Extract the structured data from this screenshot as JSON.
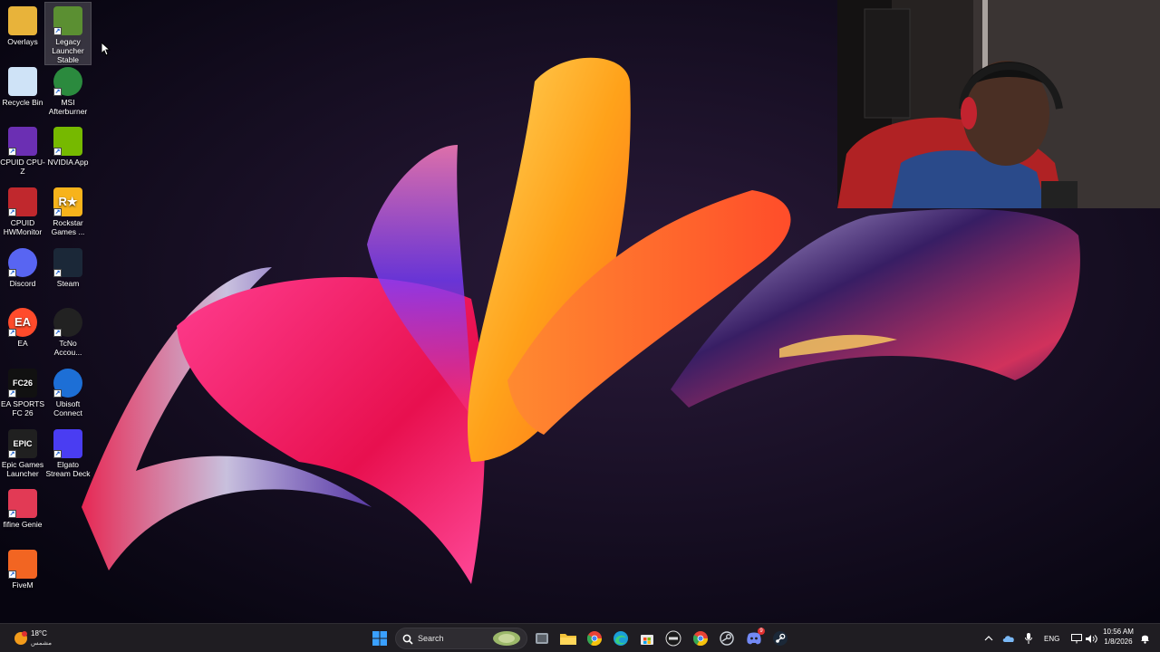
{
  "desktop": {
    "icons": [
      {
        "label": "Overlays",
        "icon": "folder-icon",
        "color": "#e8b33a"
      },
      {
        "label": "Legacy Launcher Stable",
        "icon": "minecraft-grass-block-icon",
        "color": "#5b8f32"
      },
      {
        "label": "Recycle Bin",
        "icon": "recycle-bin-icon",
        "color": "#cfe3f7"
      },
      {
        "label": "MSI Afterburner",
        "icon": "msi-afterburner-icon",
        "color": "#2b8a3e"
      },
      {
        "label": "CPUID CPU-Z",
        "icon": "cpu-z-icon",
        "color": "#6b2fb3"
      },
      {
        "label": "NVIDIA App",
        "icon": "nvidia-icon",
        "color": "#76b900"
      },
      {
        "label": "CPUID HWMonitor",
        "icon": "hwmonitor-icon",
        "color": "#c0282d"
      },
      {
        "label": "Rockstar Games ...",
        "icon": "rockstar-icon",
        "color": "#f7b31b"
      },
      {
        "label": "Discord",
        "icon": "discord-icon",
        "color": "#5865f2"
      },
      {
        "label": "Steam",
        "icon": "steam-icon",
        "color": "#1b2838"
      },
      {
        "label": "EA",
        "icon": "ea-icon",
        "color": "#ff4b2b"
      },
      {
        "label": "TcNo Accou...",
        "icon": "tcno-icon",
        "color": "#222222"
      },
      {
        "label": "EA SPORTS FC 26",
        "icon": "ea-fc-icon",
        "color": "#111111"
      },
      {
        "label": "Ubisoft Connect",
        "icon": "ubisoft-icon",
        "color": "#1d6fd6"
      },
      {
        "label": "Epic Games Launcher",
        "icon": "epic-games-icon",
        "color": "#202020"
      },
      {
        "label": "Elgato Stream Deck",
        "icon": "stream-deck-icon",
        "color": "#4a3df2"
      },
      {
        "label": "fifine Genie",
        "icon": "fifine-icon",
        "color": "#e23a55"
      },
      {
        "label": "FiveM",
        "icon": "fivem-icon",
        "color": "#f26522"
      }
    ],
    "icon_glyphs": {
      "EA": "EA",
      "EA SPORTS FC 26": "FC26",
      "Epic Games Launcher": "EPIC",
      "Rockstar Games ...": "R★"
    }
  },
  "taskbar": {
    "weather": {
      "temperature": "18°C",
      "condition": "مشمس"
    },
    "search_label": "Search",
    "pinned": [
      "windows-start-icon",
      "search-icon",
      "task-view-icon",
      "file-explorer-icon",
      "chrome-icon",
      "edge-icon",
      "microsoft-store-icon",
      "epic-games-icon",
      "chrome-icon",
      "steam-client-icon",
      "discord-icon",
      "steam-icon"
    ],
    "discord_badge": "9",
    "tray": {
      "language": "ENG",
      "time": "10:56 AM",
      "date": "1/8/2026"
    }
  }
}
